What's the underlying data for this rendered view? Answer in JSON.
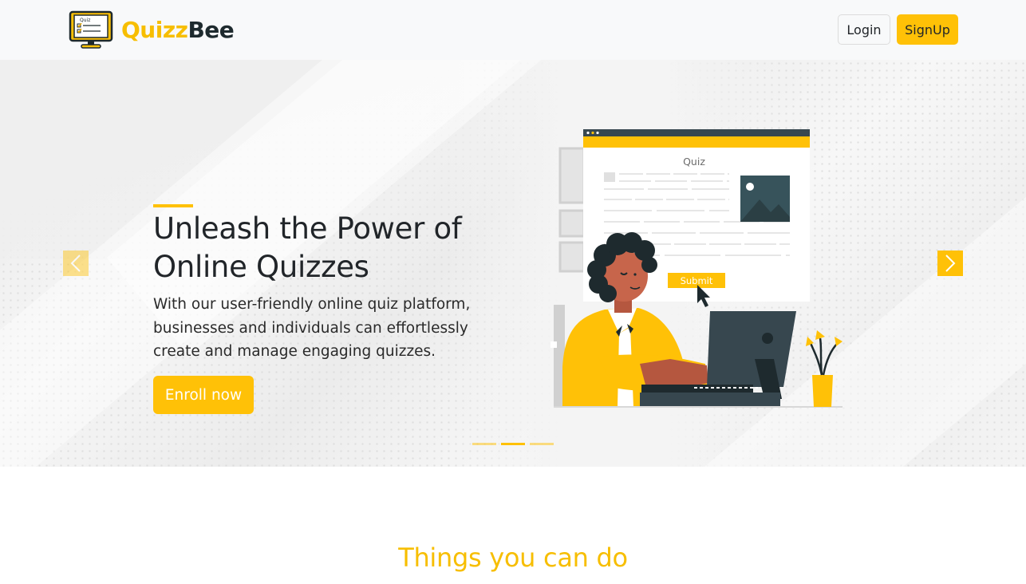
{
  "navbar": {
    "brand_quizz": "Quizz",
    "brand_bee": "Bee",
    "logo_icon": "computer-quiz-icon",
    "login_label": "Login",
    "signup_label": "SignUp"
  },
  "hero": {
    "title": "Unleash the Power of Online Quizzes",
    "description": "With our user-friendly online quiz platform, businesses and individuals can effortlessly create and manage engaging quizzes.",
    "enroll_label": "Enroll now",
    "prev_icon": "chevron-left-icon",
    "next_icon": "chevron-right-icon",
    "slides_count": 3,
    "active_slide": 2,
    "illustration": {
      "window_title": "Quiz",
      "submit_label": "Submit"
    }
  },
  "section": {
    "title": "Things you can do"
  },
  "colors": {
    "accent": "#ffc107",
    "brand_yellow": "#f7be00",
    "brand_dark": "#1e2a2e",
    "navbar_bg": "#f8f9fa"
  }
}
